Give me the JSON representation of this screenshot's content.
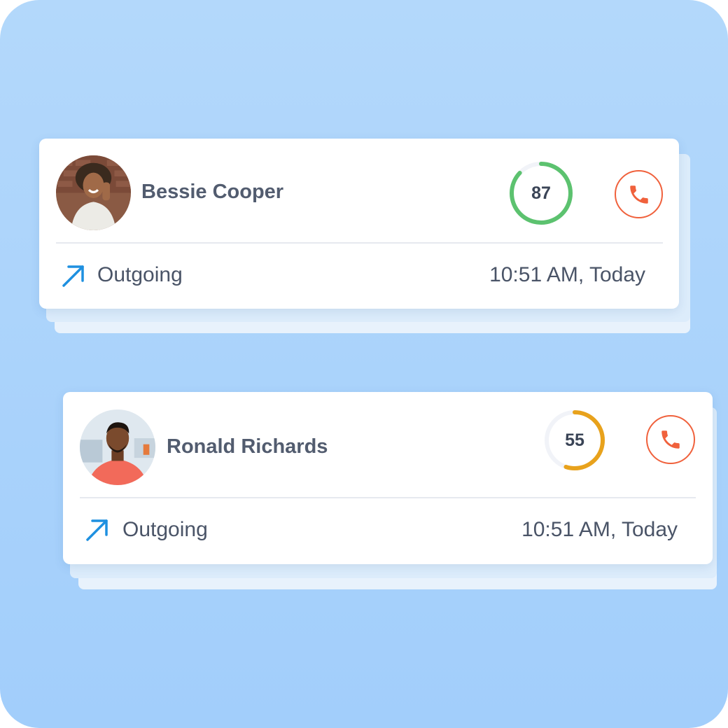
{
  "calls": [
    {
      "contact_name": "Bessie Cooper",
      "score": 87,
      "score_max": 100,
      "score_color": "#5cc26f",
      "direction_label": "Outgoing",
      "time_label": "10:51 AM, Today",
      "call_icon": "phone-icon",
      "direction_icon": "arrow-up-right-icon"
    },
    {
      "contact_name": "Ronald Richards",
      "score": 55,
      "score_max": 100,
      "score_color": "#e8a21c",
      "direction_label": "Outgoing",
      "time_label": "10:51 AM, Today",
      "call_icon": "phone-icon",
      "direction_icon": "arrow-up-right-icon"
    }
  ],
  "colors": {
    "background": "#a9d3fb",
    "accent_call": "#f0613c",
    "direction_arrow": "#1e90e0",
    "text": "#4a5467"
  }
}
